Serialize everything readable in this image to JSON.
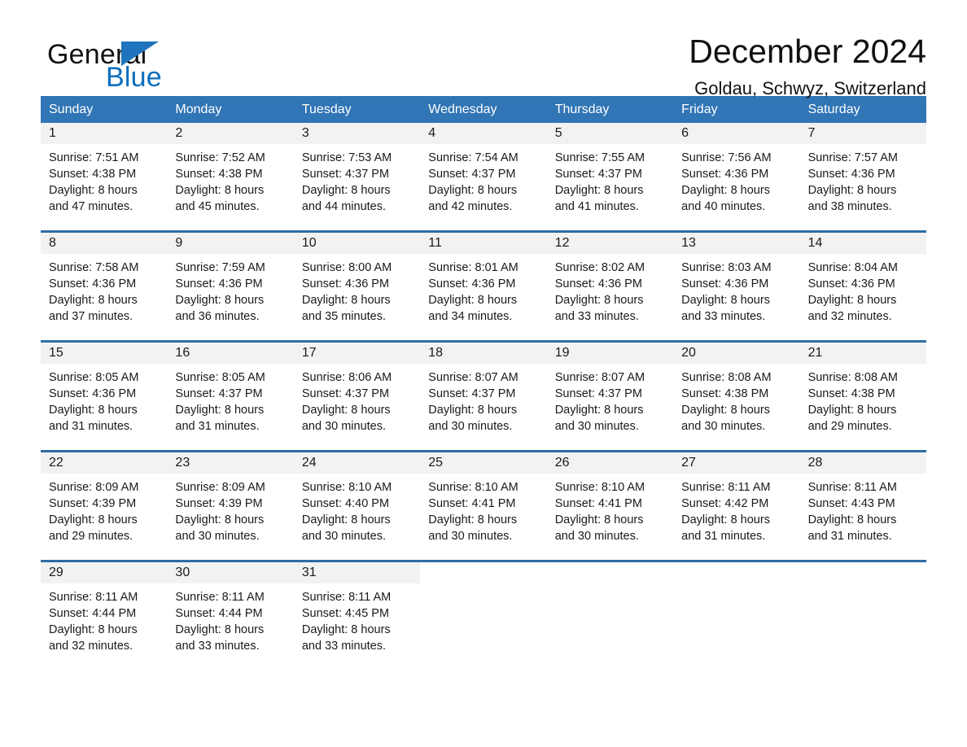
{
  "brand": {
    "name_part1": "General",
    "name_part2": "Blue",
    "triangle_color": "#1f74bd",
    "blue_color": "#0a6ebd"
  },
  "header": {
    "title": "December 2024",
    "location": "Goldau, Schwyz, Switzerland"
  },
  "theme": {
    "header_blue": "#3075b5",
    "row_separator_blue": "#2e6da4",
    "daynum_band": "#f2f2f2"
  },
  "weekdays": [
    "Sunday",
    "Monday",
    "Tuesday",
    "Wednesday",
    "Thursday",
    "Friday",
    "Saturday"
  ],
  "weeks": [
    {
      "days": [
        {
          "date": "1",
          "sunrise": "Sunrise: 7:51 AM",
          "sunset": "Sunset: 4:38 PM",
          "daylight_line1": "Daylight: 8 hours",
          "daylight_line2": "and 47 minutes."
        },
        {
          "date": "2",
          "sunrise": "Sunrise: 7:52 AM",
          "sunset": "Sunset: 4:38 PM",
          "daylight_line1": "Daylight: 8 hours",
          "daylight_line2": "and 45 minutes."
        },
        {
          "date": "3",
          "sunrise": "Sunrise: 7:53 AM",
          "sunset": "Sunset: 4:37 PM",
          "daylight_line1": "Daylight: 8 hours",
          "daylight_line2": "and 44 minutes."
        },
        {
          "date": "4",
          "sunrise": "Sunrise: 7:54 AM",
          "sunset": "Sunset: 4:37 PM",
          "daylight_line1": "Daylight: 8 hours",
          "daylight_line2": "and 42 minutes."
        },
        {
          "date": "5",
          "sunrise": "Sunrise: 7:55 AM",
          "sunset": "Sunset: 4:37 PM",
          "daylight_line1": "Daylight: 8 hours",
          "daylight_line2": "and 41 minutes."
        },
        {
          "date": "6",
          "sunrise": "Sunrise: 7:56 AM",
          "sunset": "Sunset: 4:36 PM",
          "daylight_line1": "Daylight: 8 hours",
          "daylight_line2": "and 40 minutes."
        },
        {
          "date": "7",
          "sunrise": "Sunrise: 7:57 AM",
          "sunset": "Sunset: 4:36 PM",
          "daylight_line1": "Daylight: 8 hours",
          "daylight_line2": "and 38 minutes."
        }
      ]
    },
    {
      "days": [
        {
          "date": "8",
          "sunrise": "Sunrise: 7:58 AM",
          "sunset": "Sunset: 4:36 PM",
          "daylight_line1": "Daylight: 8 hours",
          "daylight_line2": "and 37 minutes."
        },
        {
          "date": "9",
          "sunrise": "Sunrise: 7:59 AM",
          "sunset": "Sunset: 4:36 PM",
          "daylight_line1": "Daylight: 8 hours",
          "daylight_line2": "and 36 minutes."
        },
        {
          "date": "10",
          "sunrise": "Sunrise: 8:00 AM",
          "sunset": "Sunset: 4:36 PM",
          "daylight_line1": "Daylight: 8 hours",
          "daylight_line2": "and 35 minutes."
        },
        {
          "date": "11",
          "sunrise": "Sunrise: 8:01 AM",
          "sunset": "Sunset: 4:36 PM",
          "daylight_line1": "Daylight: 8 hours",
          "daylight_line2": "and 34 minutes."
        },
        {
          "date": "12",
          "sunrise": "Sunrise: 8:02 AM",
          "sunset": "Sunset: 4:36 PM",
          "daylight_line1": "Daylight: 8 hours",
          "daylight_line2": "and 33 minutes."
        },
        {
          "date": "13",
          "sunrise": "Sunrise: 8:03 AM",
          "sunset": "Sunset: 4:36 PM",
          "daylight_line1": "Daylight: 8 hours",
          "daylight_line2": "and 33 minutes."
        },
        {
          "date": "14",
          "sunrise": "Sunrise: 8:04 AM",
          "sunset": "Sunset: 4:36 PM",
          "daylight_line1": "Daylight: 8 hours",
          "daylight_line2": "and 32 minutes."
        }
      ]
    },
    {
      "days": [
        {
          "date": "15",
          "sunrise": "Sunrise: 8:05 AM",
          "sunset": "Sunset: 4:36 PM",
          "daylight_line1": "Daylight: 8 hours",
          "daylight_line2": "and 31 minutes."
        },
        {
          "date": "16",
          "sunrise": "Sunrise: 8:05 AM",
          "sunset": "Sunset: 4:37 PM",
          "daylight_line1": "Daylight: 8 hours",
          "daylight_line2": "and 31 minutes."
        },
        {
          "date": "17",
          "sunrise": "Sunrise: 8:06 AM",
          "sunset": "Sunset: 4:37 PM",
          "daylight_line1": "Daylight: 8 hours",
          "daylight_line2": "and 30 minutes."
        },
        {
          "date": "18",
          "sunrise": "Sunrise: 8:07 AM",
          "sunset": "Sunset: 4:37 PM",
          "daylight_line1": "Daylight: 8 hours",
          "daylight_line2": "and 30 minutes."
        },
        {
          "date": "19",
          "sunrise": "Sunrise: 8:07 AM",
          "sunset": "Sunset: 4:37 PM",
          "daylight_line1": "Daylight: 8 hours",
          "daylight_line2": "and 30 minutes."
        },
        {
          "date": "20",
          "sunrise": "Sunrise: 8:08 AM",
          "sunset": "Sunset: 4:38 PM",
          "daylight_line1": "Daylight: 8 hours",
          "daylight_line2": "and 30 minutes."
        },
        {
          "date": "21",
          "sunrise": "Sunrise: 8:08 AM",
          "sunset": "Sunset: 4:38 PM",
          "daylight_line1": "Daylight: 8 hours",
          "daylight_line2": "and 29 minutes."
        }
      ]
    },
    {
      "days": [
        {
          "date": "22",
          "sunrise": "Sunrise: 8:09 AM",
          "sunset": "Sunset: 4:39 PM",
          "daylight_line1": "Daylight: 8 hours",
          "daylight_line2": "and 29 minutes."
        },
        {
          "date": "23",
          "sunrise": "Sunrise: 8:09 AM",
          "sunset": "Sunset: 4:39 PM",
          "daylight_line1": "Daylight: 8 hours",
          "daylight_line2": "and 30 minutes."
        },
        {
          "date": "24",
          "sunrise": "Sunrise: 8:10 AM",
          "sunset": "Sunset: 4:40 PM",
          "daylight_line1": "Daylight: 8 hours",
          "daylight_line2": "and 30 minutes."
        },
        {
          "date": "25",
          "sunrise": "Sunrise: 8:10 AM",
          "sunset": "Sunset: 4:41 PM",
          "daylight_line1": "Daylight: 8 hours",
          "daylight_line2": "and 30 minutes."
        },
        {
          "date": "26",
          "sunrise": "Sunrise: 8:10 AM",
          "sunset": "Sunset: 4:41 PM",
          "daylight_line1": "Daylight: 8 hours",
          "daylight_line2": "and 30 minutes."
        },
        {
          "date": "27",
          "sunrise": "Sunrise: 8:11 AM",
          "sunset": "Sunset: 4:42 PM",
          "daylight_line1": "Daylight: 8 hours",
          "daylight_line2": "and 31 minutes."
        },
        {
          "date": "28",
          "sunrise": "Sunrise: 8:11 AM",
          "sunset": "Sunset: 4:43 PM",
          "daylight_line1": "Daylight: 8 hours",
          "daylight_line2": "and 31 minutes."
        }
      ]
    },
    {
      "days": [
        {
          "date": "29",
          "sunrise": "Sunrise: 8:11 AM",
          "sunset": "Sunset: 4:44 PM",
          "daylight_line1": "Daylight: 8 hours",
          "daylight_line2": "and 32 minutes."
        },
        {
          "date": "30",
          "sunrise": "Sunrise: 8:11 AM",
          "sunset": "Sunset: 4:44 PM",
          "daylight_line1": "Daylight: 8 hours",
          "daylight_line2": "and 33 minutes."
        },
        {
          "date": "31",
          "sunrise": "Sunrise: 8:11 AM",
          "sunset": "Sunset: 4:45 PM",
          "daylight_line1": "Daylight: 8 hours",
          "daylight_line2": "and 33 minutes."
        },
        {
          "date": "",
          "sunrise": "",
          "sunset": "",
          "daylight_line1": "",
          "daylight_line2": ""
        },
        {
          "date": "",
          "sunrise": "",
          "sunset": "",
          "daylight_line1": "",
          "daylight_line2": ""
        },
        {
          "date": "",
          "sunrise": "",
          "sunset": "",
          "daylight_line1": "",
          "daylight_line2": ""
        },
        {
          "date": "",
          "sunrise": "",
          "sunset": "",
          "daylight_line1": "",
          "daylight_line2": ""
        }
      ]
    }
  ]
}
